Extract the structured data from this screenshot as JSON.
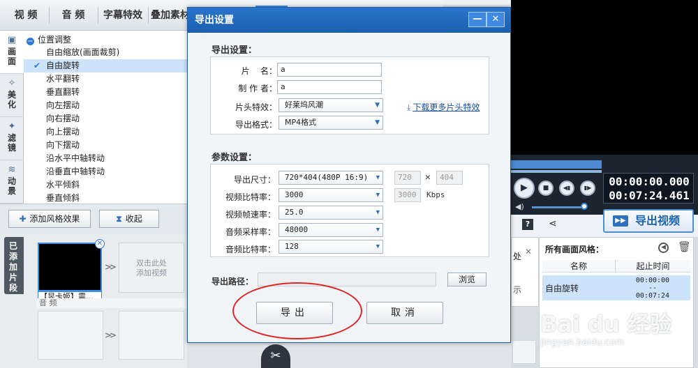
{
  "top_tabs": [
    "视  频",
    "音  频",
    "字幕特效",
    "叠加素材"
  ],
  "side_tabs": [
    {
      "label": "画面",
      "icon": "screen-icon"
    },
    {
      "label": "美化",
      "icon": "wand-icon"
    },
    {
      "label": "滤镜",
      "icon": "filter-icon"
    },
    {
      "label": "动景",
      "icon": "wave-icon"
    }
  ],
  "effect_tree": {
    "header": "位置调整",
    "items": [
      "自由缩放(画面裁剪)",
      "自由旋转",
      "水平翻转",
      "垂直翻转",
      "向左摆动",
      "向右摆动",
      "向上摆动",
      "向下摆动",
      "沿水平中轴转动",
      "沿垂直中轴转动",
      "水平倾斜",
      "垂直倾斜"
    ],
    "selected": "自由旋转"
  },
  "style_buttons": {
    "add": "添加风格效果",
    "collapse": "收起"
  },
  "clips": {
    "tab_label": "已添加片段",
    "clip_name": "【昱卡姬】震…",
    "add_hint": "双击此处\n添加视频",
    "audio_label": "音 频"
  },
  "player": {
    "current_time": "00:00:00.000",
    "total_time": "00:07:24.461",
    "export_video_label": "导出视频"
  },
  "style_panel": {
    "title": "所有画面风格：",
    "col_name": "名称",
    "col_time": "起止时间",
    "row": {
      "name": "自由旋转",
      "start": "00:00:00",
      "dash": "--",
      "end": "00:07:24"
    }
  },
  "side_hint": {
    "t1": "处",
    "t2": "示"
  },
  "dialog": {
    "title": "导出设置",
    "section_export": "导出设置：",
    "section_params": "参数设置：",
    "fields": {
      "name_label": "片    名：",
      "name_value": "a",
      "author_label": "制 作 者：",
      "author_value": "a",
      "intro_label": "片头特效：",
      "intro_value": "好莱坞风潮",
      "format_label": "导出格式：",
      "format_value": "MP4格式"
    },
    "download_link": "下载更多片头特效",
    "params": {
      "size_label": "导出尺寸：",
      "size_value": "720*404(480P 16:9)",
      "width": "720",
      "height": "404",
      "vbitrate_label": "视频比特率：",
      "vbitrate_value": "3000",
      "vbitrate_custom": "3000",
      "vbitrate_unit": "Kbps",
      "framerate_label": "视频帧速率：",
      "framerate_value": "25.0",
      "samplerate_label": "音频采样率：",
      "samplerate_value": "48000",
      "abitrate_label": "音频比特率：",
      "abitrate_value": "128"
    },
    "path_label": "导出路径：",
    "browse": "浏览",
    "export_btn": "导出",
    "cancel_btn": "取消"
  },
  "watermark": {
    "main": "Bai du 经验",
    "sub": "jingyan.baidu.com"
  }
}
